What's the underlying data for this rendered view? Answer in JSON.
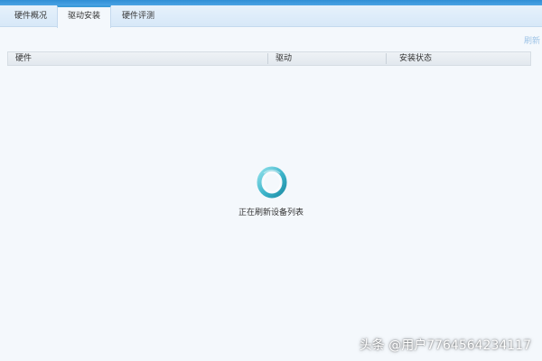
{
  "tabs": [
    {
      "label": "硬件概况",
      "active": false
    },
    {
      "label": "驱动安装",
      "active": true
    },
    {
      "label": "硬件评测",
      "active": false
    }
  ],
  "toolbar": {
    "refresh_label": "刷新"
  },
  "table": {
    "columns": [
      "硬件",
      "驱动",
      "安装状态"
    ]
  },
  "loading": {
    "icon": "loading-ring-icon",
    "text": "正在刷新设备列表"
  },
  "watermark": {
    "text": "头条 @用户7764564234117"
  },
  "colors": {
    "accent": "#3a9ad9",
    "spinner_teal": "#3bb3c9",
    "background": "#f4f8fc"
  }
}
